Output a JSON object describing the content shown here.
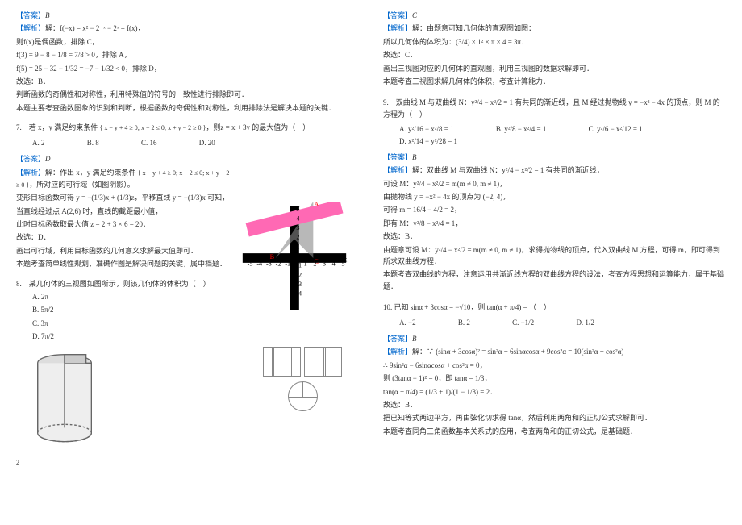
{
  "left": {
    "ans6_label": "【答案】",
    "ans6_val": "B",
    "exp6_label": "【解析】",
    "exp6_l1": "解：f(−x) = x² − 2⁻ˣ − 2ˣ = f(x)，",
    "exp6_l2": "则f(x)是偶函数，排除 C，",
    "exp6_l3": "f(3) = 9 − 8 − 1/8 = 7/8 > 0，排除 A，",
    "exp6_l4": "f(5) = 25 − 32 − 1/32 = −7 − 1/32 < 0，排除 D，",
    "exp6_l5": "故选：B．",
    "exp6_l6": "判断函数的奇偶性和对称性，利用特殊值的符号的一致性进行排除即可．",
    "exp6_l7": "本题主要考查函数图象的识别和判断，根据函数的奇偶性和对称性，利用排除法是解决本题的关键．",
    "q7": "7.　若 x，y 满足约束条件",
    "q7_sys": "{ x − y + 4 ≥ 0; x − 2 ≤ 0; x + y − 2 ≥ 0 }",
    "q7_tail": "，则z = x + 3y 的最大值为（　）",
    "q7a": "A. 2",
    "q7b": "B. 8",
    "q7c": "C. 16",
    "q7d": "D. 20",
    "ans7_label": "【答案】",
    "ans7_val": "D",
    "exp7_label": "【解析】",
    "exp7_l1": "解：作出 x，y 满足约束条件",
    "exp7_sys": "{ x − y + 4 ≥ 0; x − 2 ≤ 0; x + y − 2 ≥ 0 }",
    "exp7_tail": "，所对应的可行域（如图阴影）。",
    "exp7_l2": "变形目标函数可得 y = −(1/3)x + (1/3)z，平移直线 y = −(1/3)x 可知，",
    "exp7_l3": "当直线经过点 A(2,6) 时，直线的截距最小值，",
    "exp7_l4": "此时目标函数取最大值 z = 2 + 3 × 6 = 20．",
    "exp7_l5": "故选：D．",
    "exp7_l6": "画出可行域，利用目标函数的几何意义求解最大值即可．",
    "exp7_l7": "本题考查简单线性规划，准确作图是解决问题的关键，属中档题．",
    "q8": "8.　某几何体的三视图如图所示，则该几何体的体积为（　）",
    "q8a": "A. 2π",
    "q8b": "B. 5π/2",
    "q8c": "C. 3π",
    "q8d": "D. 7π/2",
    "pagenum": "2"
  },
  "right": {
    "ans8_label": "【答案】",
    "ans8_val": "C",
    "exp8_label": "【解析】",
    "exp8_l1": "解：由题意可知几何体的直观图如图：",
    "exp8_l2": "所以几何体的体积为：(3/4) × 1² × π × 4 = 3π．",
    "exp8_l3": "故选：C．",
    "exp8_l4": "画出三视图对应的几何体的直观图，利用三视图的数据求解即可．",
    "exp8_l5": "本题考查三视图求解几何体的体积，考查计算能力．",
    "q9": "9.　双曲线 M 与双曲线 N：y²/4 − x²/2 = 1 有共同的渐近线，且 M 经过抛物线 y = −x² − 4x 的顶点，则 M 的方程为（　）",
    "q9a": "A. y²/16 − x²/8 = 1",
    "q9b": "B. y²/8 − x²/4 = 1",
    "q9c": "C. y²/6 − x²/12 = 1",
    "q9d": "D. x²/14 − y²/28 = 1",
    "ans9_label": "【答案】",
    "ans9_val": "B",
    "exp9_label": "【解析】",
    "exp9_l1": "解：双曲线 M 与双曲线 N：y²/4 − x²/2 = 1 有共同的渐近线，",
    "exp9_l2": "可设 M：y²/4 − x²/2 = m(m ≠ 0, m ≠ 1)，",
    "exp9_l3": "由抛物线 y = −x² − 4x 的顶点为 (−2, 4)，",
    "exp9_l4": "可得 m = 16/4 − 4/2 = 2，",
    "exp9_l5": "即有 M：y²/8 − x²/4 = 1，",
    "exp9_l6": "故选：B．",
    "exp9_l7": "由题意可设 M：y²/4 − x²/2 = m(m ≠ 0, m ≠ 1)，求得抛物线的顶点，代入双曲线 M 方程，可得 m，即可得到所求双曲线方程．",
    "exp9_l8": "本题考查双曲线的方程，注意运用共渐近线方程的双曲线方程的设法，考查方程思想和运算能力，属于基础题．",
    "q10": "10. 已知 sinα + 3cosα = −√10，则 tan(α + π/4) = （　）",
    "q10a": "A. −2",
    "q10b": "B. 2",
    "q10c": "C. −1/2",
    "q10d": "D. 1/2",
    "ans10_label": "【答案】",
    "ans10_val": "B",
    "exp10_label": "【解析】",
    "exp10_l1": "解：∵ (sinα + 3cosα)² = sin²α + 6sinαcosα + 9cos²α = 10(sin²α + cos²α)",
    "exp10_l2": "∴ 9sin²α − 6sinαcosα + cos²α = 0，",
    "exp10_l3": "则 (3tanα − 1)² = 0，即 tanα = 1/3，",
    "exp10_l4": "tan(α + π/4) = (1/3 + 1)/(1 − 1/3) = 2．",
    "exp10_l5": "故选：B．",
    "exp10_l6": "把已知等式两边平方，再由弦化切求得 tanα，然后利用两角和的正切公式求解即可．",
    "exp10_l7": "本题考查同角三角函数基本关系式的应用，考查两角和的正切公式，是基础题．"
  }
}
